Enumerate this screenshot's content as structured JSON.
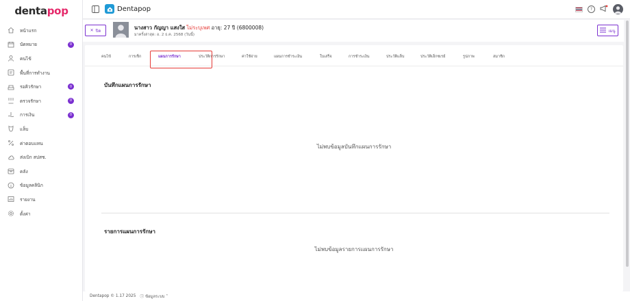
{
  "brand": {
    "logo_main": "denta",
    "logo_accent": "pop",
    "accent_color": "#7a2fd0",
    "logo_accent_color": "#e5286a"
  },
  "sidebar": {
    "items": [
      {
        "label": "หน้าแรก",
        "icon": "home-icon"
      },
      {
        "label": "นัดหมาย",
        "icon": "calendar-icon",
        "badge": "0"
      },
      {
        "label": "คนไข้",
        "icon": "user-icon"
      },
      {
        "label": "พื้นที่การทำงาน",
        "icon": "workspace-icon"
      },
      {
        "label": "รอคิวรักษา",
        "icon": "queue-icon",
        "badge": "0"
      },
      {
        "label": "ตรวจรักษา",
        "icon": "treatment-icon",
        "badge": "0"
      },
      {
        "label": "การเงิน",
        "icon": "finance-icon",
        "badge": "0"
      },
      {
        "label": "แล็บ",
        "icon": "lab-icon"
      },
      {
        "label": "ค่าตอบแทน",
        "icon": "percent-icon"
      },
      {
        "label": "ส่งเบิก สปสช.",
        "icon": "cloud-icon"
      },
      {
        "label": "คลัง",
        "icon": "inventory-icon"
      },
      {
        "label": "ข้อมูลคลินิก",
        "icon": "info-icon"
      },
      {
        "label": "รายงาน",
        "icon": "report-icon"
      },
      {
        "label": "ตั้งค่า",
        "icon": "gear-icon"
      }
    ]
  },
  "topbar": {
    "title": "Dentapop"
  },
  "patient": {
    "close_label": "ปิด",
    "name": "นางสาว กัญญา แสงใส",
    "gender": "ไม่ระบุเพศ",
    "age": "อายุ: 27 ปี",
    "hn": "(6800008)",
    "last_visit": "มาครั้งล่าสุด: อ. 2 ธ.ค. 2568 (วันนี้)",
    "menu_label": "เมนู"
  },
  "tabs": [
    {
      "label": "คนไข้"
    },
    {
      "label": "การเช็ก"
    },
    {
      "label": "แผนการรักษา",
      "active": true
    },
    {
      "label": "ประวัติการรักษา"
    },
    {
      "label": "ค่าใช้จ่าย"
    },
    {
      "label": "แผนการชำระเงิน"
    },
    {
      "label": "ใบเสร็จ"
    },
    {
      "label": "การชำระเงิน"
    },
    {
      "label": "ประวัติแล็บ"
    },
    {
      "label": "ประวัติเอ็กซเรย์"
    },
    {
      "label": "รูปภาพ"
    },
    {
      "label": "สมาชิก"
    }
  ],
  "sections": {
    "plan_notes_title": "บันทึกแผนการรักษา",
    "plan_notes_empty": "ไม่พบข้อมูลบันทึกแผนการรักษา",
    "plan_list_title": "รายการแผนการรักษา",
    "plan_list_empty": "ไม่พบข้อมูลรายการแผนการรักษา"
  },
  "footer": {
    "copyright": "Dentapop © 1.17 2025",
    "system_info": "ข้อมูลระบบ"
  }
}
